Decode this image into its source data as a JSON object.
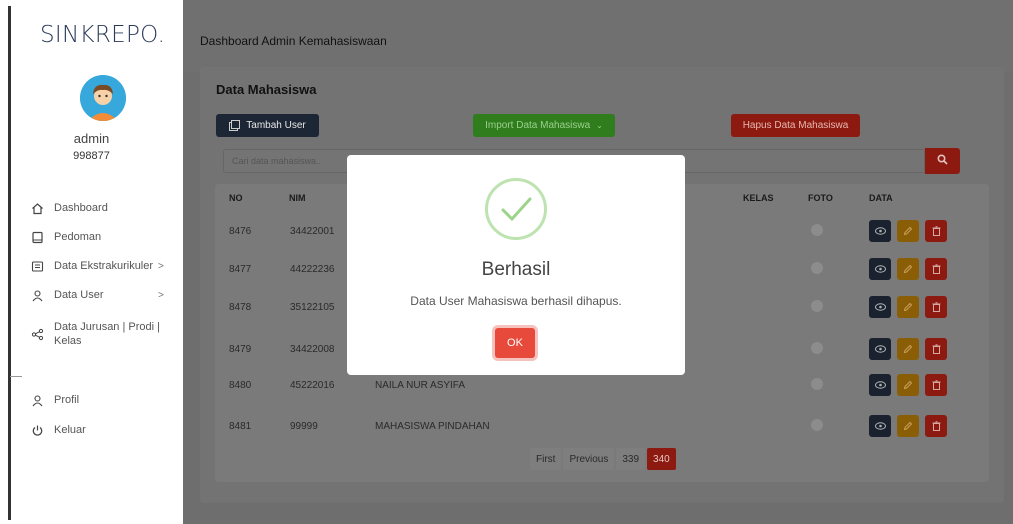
{
  "sidebar": {
    "brand": "SINKREPO.",
    "user_name": "admin",
    "user_id": "998877",
    "items": [
      {
        "label": "Dashboard",
        "icon": "home-icon"
      },
      {
        "label": "Pedoman",
        "icon": "book-icon"
      },
      {
        "label": "Data Ekstrakurikuler",
        "icon": "list-icon",
        "chevron": ">"
      },
      {
        "label": "Data User",
        "icon": "user-icon",
        "chevron": ">"
      },
      {
        "label": "Data Jurusan | Prodi |",
        "label2": "Kelas",
        "icon": "share-icon"
      },
      {
        "label": "Profil",
        "icon": "user-icon"
      },
      {
        "label": "Keluar",
        "icon": "power-icon"
      }
    ]
  },
  "header": {
    "title": "Dashboard Admin Kemahasiswaan"
  },
  "main": {
    "card_title": "Data Mahasiswa",
    "add_button": "Tambah User",
    "import_button": "Import Data Mahasiswa",
    "delete_all_button": "Hapus Data Mahasiswa",
    "search_placeholder": "Cari data mahasiswa..",
    "columns": [
      "NO",
      "NIM",
      "KELAS",
      "FOTO",
      "DATA"
    ],
    "rows": [
      {
        "no": "8476",
        "nim": "34422001",
        "name": ""
      },
      {
        "no": "8477",
        "nim": "44222236",
        "name": ""
      },
      {
        "no": "8478",
        "nim": "35122105",
        "name": ""
      },
      {
        "no": "8479",
        "nim": "34422008",
        "name": ""
      },
      {
        "no": "8480",
        "nim": "45222016",
        "name": "NAILA NUR ASYIFA"
      },
      {
        "no": "8481",
        "nim": "99999",
        "name": "MAHASISWA PINDAHAN"
      }
    ],
    "pagination": [
      "First",
      "Previous",
      "339",
      "340"
    ]
  },
  "modal": {
    "title": "Berhasil",
    "message": "Data User Mahasiswa berhasil dihapus.",
    "ok_label": "OK"
  },
  "colors": {
    "danger": "#e74a3b",
    "success": "#2f7d1c",
    "dark": "#1d2634",
    "warning": "#e0a100"
  }
}
